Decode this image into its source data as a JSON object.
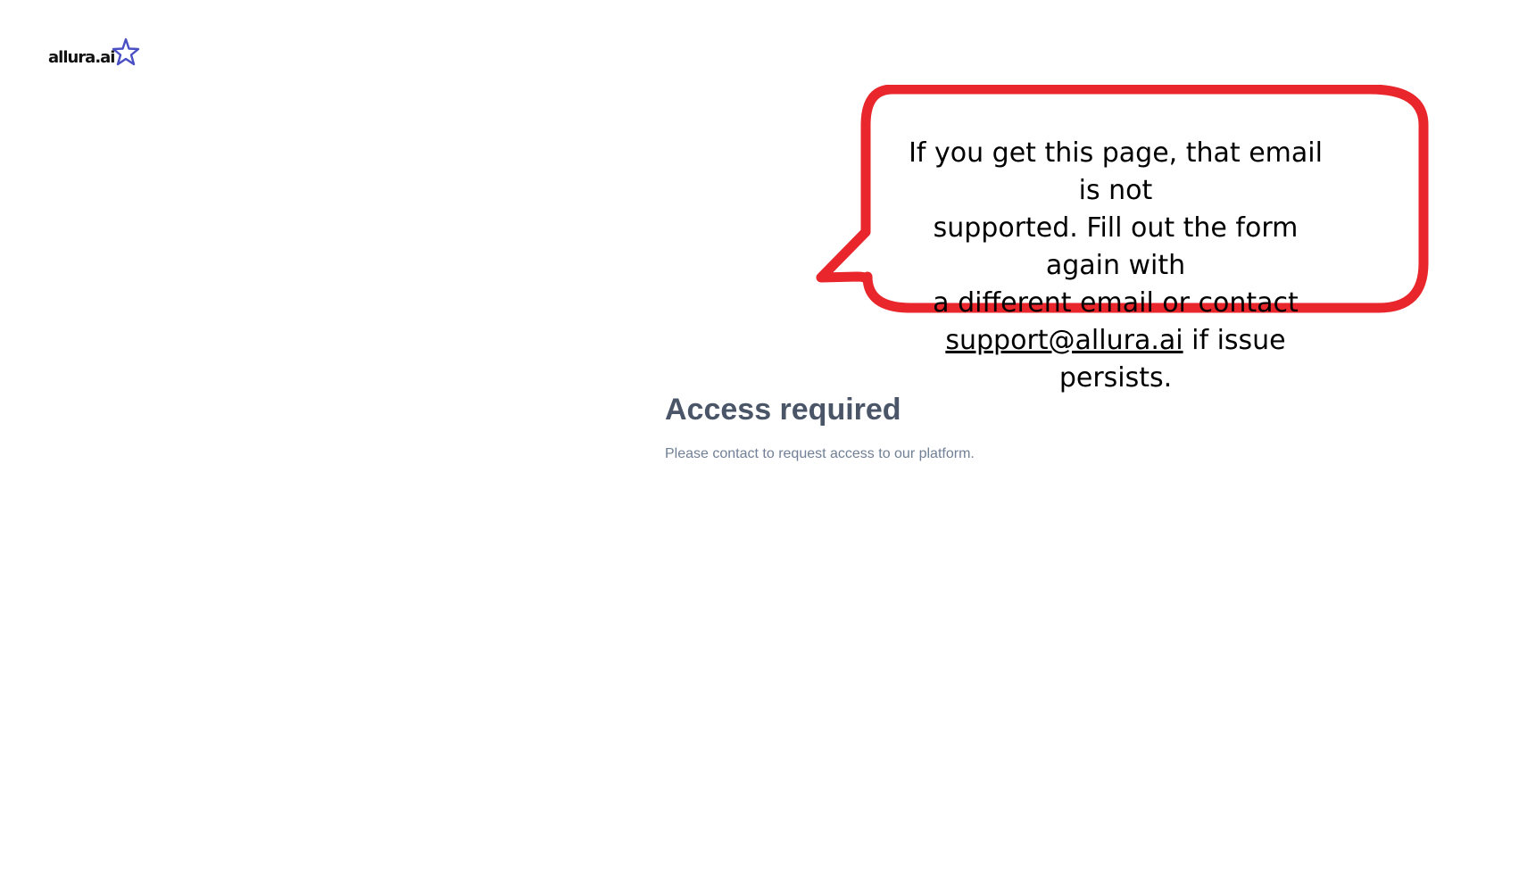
{
  "brand": {
    "name": "allura.ai",
    "accent_color": "#4a4fc4",
    "icon": "star-icon"
  },
  "callout": {
    "border_color": "#e8262b",
    "line_1": "If you get this page, that email is not",
    "line_2": "supported. Fill out the form again with",
    "line_3": "a different email or contact",
    "email": "support@allura.ai",
    "line_4_suffix": " if issue persists."
  },
  "main": {
    "title": "Access required",
    "message": "Please contact to request access to our platform."
  }
}
